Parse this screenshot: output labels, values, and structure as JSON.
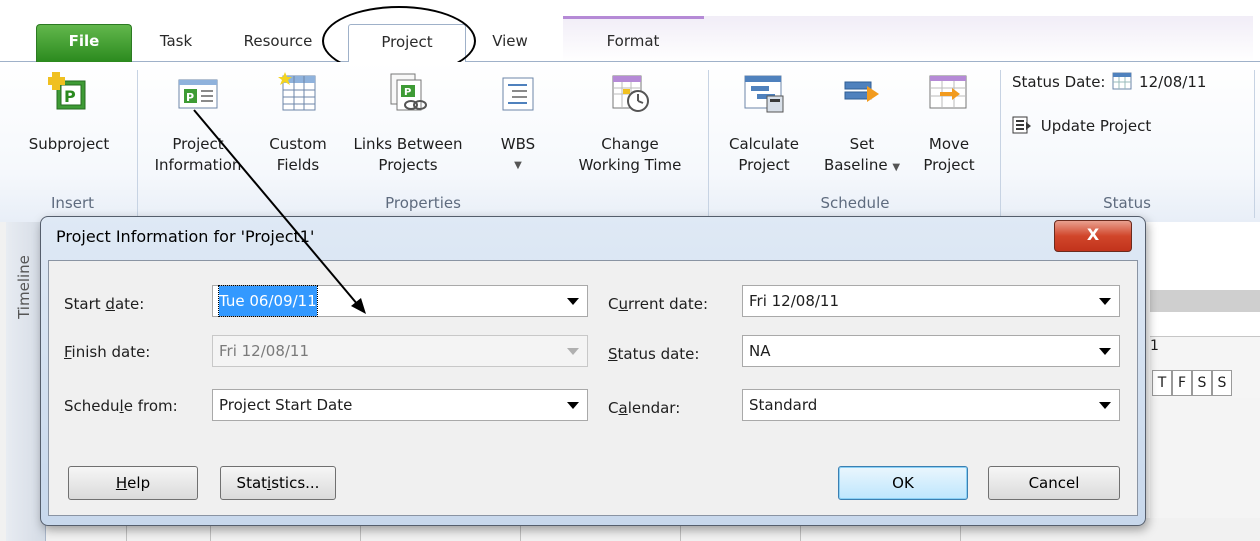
{
  "ribbon": {
    "tabs": {
      "file": "File",
      "task": "Task",
      "resource": "Resource",
      "project": "Project",
      "view": "View",
      "format": "Format"
    },
    "insert_group": {
      "label": "Insert",
      "subproject": "Subproject"
    },
    "properties_group": {
      "label": "Properties",
      "project_information": [
        "Project",
        "Information"
      ],
      "custom_fields": [
        "Custom",
        "Fields"
      ],
      "links_between_projects": [
        "Links Between",
        "Projects"
      ],
      "wbs": "WBS",
      "change_working_time": [
        "Change",
        "Working Time"
      ]
    },
    "schedule_group": {
      "label": "Schedule",
      "calculate_project": [
        "Calculate",
        "Project"
      ],
      "set_baseline": [
        "Set",
        "Baseline"
      ],
      "move_project": [
        "Move",
        "Project"
      ]
    },
    "status_group": {
      "label": "Status",
      "status_date_label": "Status Date:",
      "status_date_value": "12/08/11",
      "update_project": "Update Project"
    }
  },
  "background": {
    "timeline_label": "Timeline",
    "week_fragment": "1",
    "day_letters": [
      "T",
      "F",
      "S",
      "S"
    ]
  },
  "dialog": {
    "title": "Project Information for 'Project1'",
    "close_glyph": "X",
    "fields": {
      "start_date": {
        "label_pre": "Start ",
        "label_mn": "d",
        "label_post": "ate:",
        "value": "Tue 06/09/11"
      },
      "finish_date": {
        "label_pre": "",
        "label_mn": "F",
        "label_post": "inish date:",
        "value": "Fri 12/08/11"
      },
      "schedule_from": {
        "label_pre": "Schedu",
        "label_mn": "l",
        "label_post": "e from:",
        "value": "Project Start Date"
      },
      "current_date": {
        "label_pre": "C",
        "label_mn": "u",
        "label_post": "rrent date:",
        "value": "Fri 12/08/11"
      },
      "status_date": {
        "label_pre": "",
        "label_mn": "S",
        "label_post": "tatus date:",
        "value": "NA"
      },
      "calendar": {
        "label_pre": "C",
        "label_mn": "a",
        "label_post": "lendar:",
        "value": "Standard"
      }
    },
    "buttons": {
      "help_mn": "H",
      "help_rest": "elp",
      "statistics_pre": "Stat",
      "statistics_mn": "i",
      "statistics_post": "stics...",
      "ok": "OK",
      "cancel": "Cancel"
    }
  },
  "colors": {
    "file_tab": "#2b8a1e",
    "format_accent": "#b58ad6",
    "close_button": "#c2331c",
    "selection": "#3399ff"
  },
  "icons": [
    "subproject-icon",
    "project-information-icon",
    "custom-fields-icon",
    "links-between-projects-icon",
    "wbs-icon",
    "change-working-time-icon",
    "calculate-project-icon",
    "set-baseline-icon",
    "move-project-icon",
    "calendar-icon",
    "update-project-icon",
    "close-icon",
    "dropdown-arrow-icon"
  ]
}
